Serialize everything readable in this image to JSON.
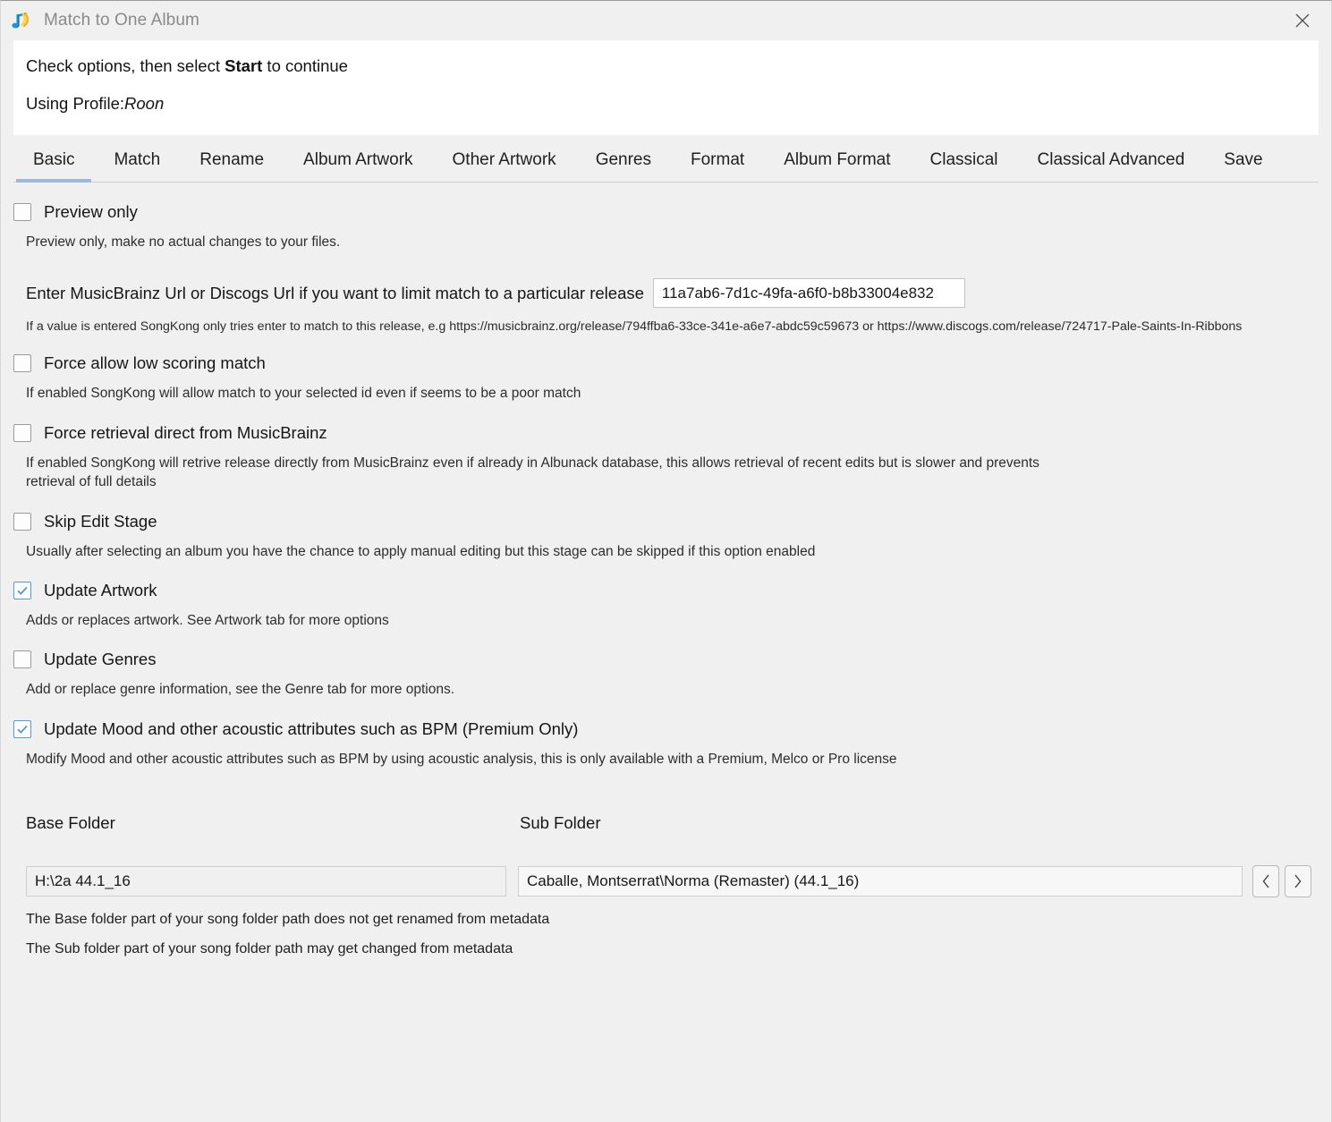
{
  "window": {
    "title": "Match to One Album",
    "app_icon": "music-note-icon",
    "close_icon": "close-icon"
  },
  "header": {
    "instruction_prefix": "Check options, then select ",
    "instruction_bold": "Start",
    "instruction_suffix": " to continue",
    "profile_label": "Using Profile:",
    "profile_value": "Roon"
  },
  "tabs": [
    {
      "label": "Basic",
      "active": true
    },
    {
      "label": "Match",
      "active": false
    },
    {
      "label": "Rename",
      "active": false
    },
    {
      "label": "Album Artwork",
      "active": false
    },
    {
      "label": "Other Artwork",
      "active": false
    },
    {
      "label": "Genres",
      "active": false
    },
    {
      "label": "Format",
      "active": false
    },
    {
      "label": "Album Format",
      "active": false
    },
    {
      "label": "Classical",
      "active": false
    },
    {
      "label": "Classical Advanced",
      "active": false
    },
    {
      "label": "Save",
      "active": false
    }
  ],
  "options": {
    "preview_only": {
      "label": "Preview only",
      "checked": false,
      "help": "Preview only, make no actual changes to your files."
    },
    "release_url": {
      "label": "Enter MusicBrainz Url or Discogs Url if you want to limit match to a particular release",
      "value": "11a7ab6-7d1c-49fa-a6f0-b8b33004e832",
      "placeholder": "",
      "help": "If a value is entered SongKong only tries enter to match to this release, e.g https://musicbrainz.org/release/794ffba6-33ce-341e-a6e7-abdc59c59673 or https://www.discogs.com/release/724717-Pale-Saints-In-Ribbons"
    },
    "force_allow_low_scoring": {
      "label": "Force allow low scoring match",
      "checked": false,
      "help": "If enabled SongKong will allow match to your selected id even if seems to be a poor match"
    },
    "force_retrieval_direct": {
      "label": "Force retrieval direct from MusicBrainz",
      "checked": false,
      "help": "If enabled SongKong will retrive release directly from MusicBrainz even if already in Albunack database, this allows retrieval of recent edits but is slower and prevents retrieval of full details"
    },
    "skip_edit_stage": {
      "label": "Skip Edit Stage",
      "checked": false,
      "help": "Usually after selecting an album you have the chance to apply manual editing but this stage can be skipped if this option enabled"
    },
    "update_artwork": {
      "label": "Update Artwork",
      "checked": true,
      "help": "Adds or replaces artwork. See Artwork tab for more options"
    },
    "update_genres": {
      "label": "Update Genres",
      "checked": false,
      "help": "Add or replace genre information, see the Genre tab for more options."
    },
    "update_mood": {
      "label": "Update Mood and other acoustic attributes such as BPM (Premium Only)",
      "checked": true,
      "help": "Modify Mood and other acoustic attributes such as BPM by using acoustic analysis, this is only available with a Premium, Melco or Pro license"
    }
  },
  "folders": {
    "base_label": "Base Folder",
    "sub_label": "Sub Folder",
    "base_value": "H:\\2a 44.1_16",
    "sub_value": "Caballe, Montserrat\\Norma (Remaster) (44.1_16)",
    "prev_icon": "chevron-left-icon",
    "next_icon": "chevron-right-icon",
    "help_base": "The Base folder part of your song folder path does not get renamed from metadata",
    "help_sub": "The Sub folder part of your song folder path may get changed from metadata"
  },
  "colors": {
    "accent": "#9dbadc",
    "checkbox_checked": "#4f9ad7",
    "window_bg": "#f0f0f0",
    "panel_bg": "#ffffff"
  }
}
